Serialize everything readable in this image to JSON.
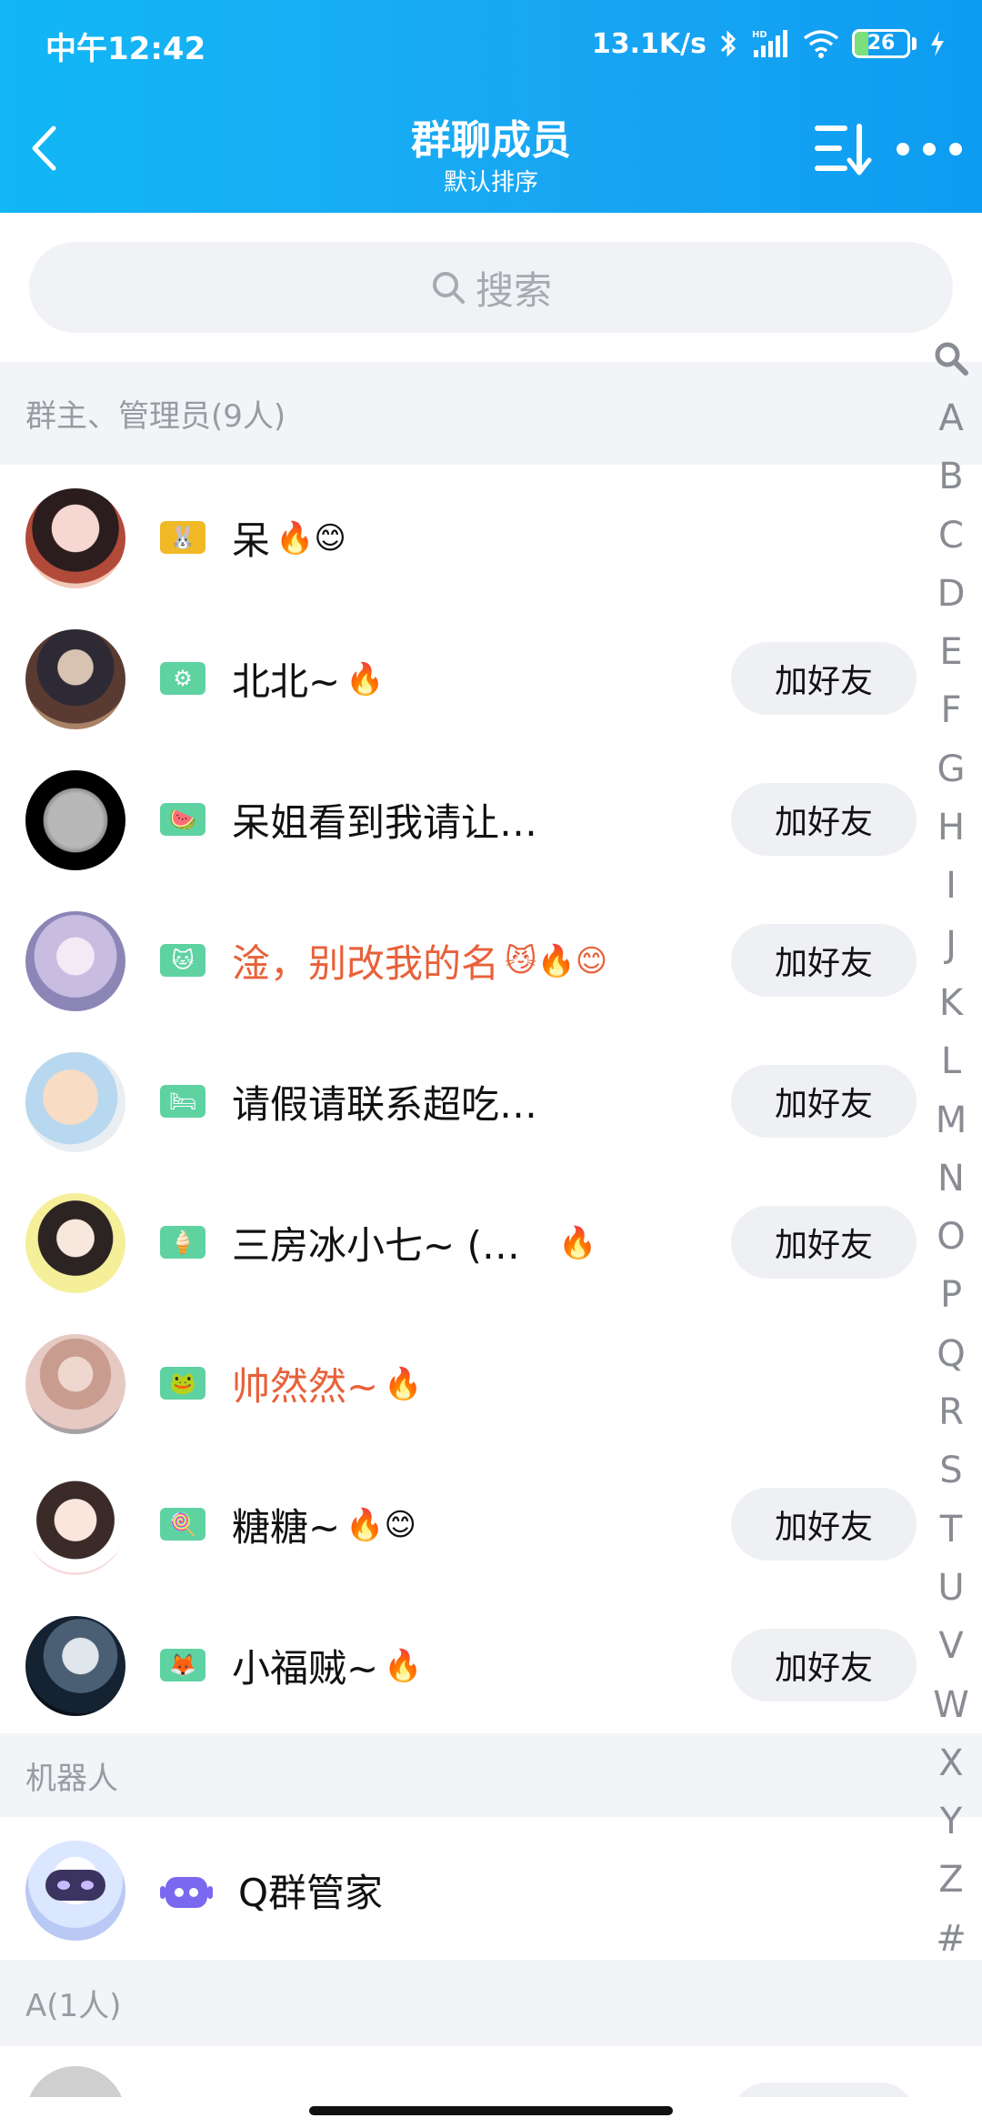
{
  "status_bar": {
    "time": "中午12:42",
    "net_speed": "13.1K/s",
    "network": "HD",
    "battery": "26"
  },
  "header": {
    "title": "群聊成员",
    "subtitle": "默认排序"
  },
  "search": {
    "placeholder": "搜索"
  },
  "sections": {
    "admins": "群主、管理员(9人)",
    "robots": "机器人",
    "a": "A(1人)"
  },
  "members": [
    {
      "name": "呆",
      "badge": "🐰",
      "emoji": "🔥😊",
      "add": ""
    },
    {
      "name": "北北~",
      "badge": "⚙",
      "emoji": "🔥",
      "add": "加好友"
    },
    {
      "name": "呆姐看到我请让…",
      "badge": "🍉",
      "emoji": "",
      "add": "加好友"
    },
    {
      "name": "淦，别改我的名",
      "badge": "🐱",
      "emoji": "😼🔥😊",
      "add": "加好友"
    },
    {
      "name": "请假请联系超吃…",
      "badge": "🛏",
      "emoji": "",
      "add": "加好友"
    },
    {
      "name": "三房冰小七~ (…",
      "badge": "🍦",
      "emoji": "🔥",
      "add": "加好友"
    },
    {
      "name": "帅然然~",
      "badge": "🐸",
      "emoji": "🔥",
      "add": ""
    },
    {
      "name": "糖糖~",
      "badge": "🍭",
      "emoji": "🔥😊",
      "add": "加好友"
    },
    {
      "name": "小福贼~",
      "badge": "🦊",
      "emoji": "🔥",
      "add": "加好友"
    }
  ],
  "robot": {
    "name": "Q群管家"
  },
  "alpha_index": [
    "A",
    "B",
    "C",
    "D",
    "E",
    "F",
    "G",
    "H",
    "I",
    "J",
    "K",
    "L",
    "M",
    "N",
    "O",
    "P",
    "Q",
    "R",
    "S",
    "T",
    "U",
    "V",
    "W",
    "X",
    "Y",
    "Z",
    "#"
  ]
}
